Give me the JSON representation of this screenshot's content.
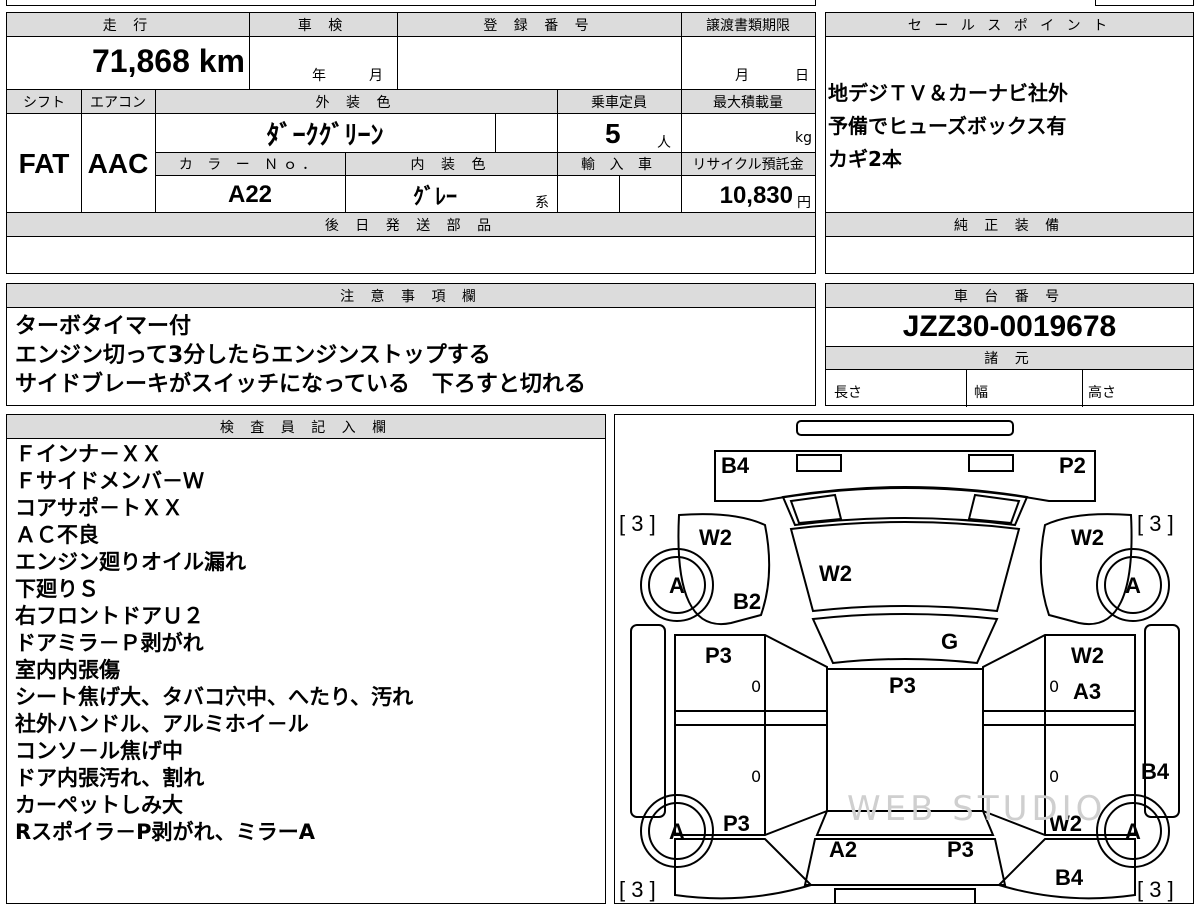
{
  "top_info": {
    "mileage_label": "走 行",
    "mileage_value": "71,868",
    "mileage_unit": "km",
    "inspection_label": "車 検",
    "inspection_year": "年",
    "inspection_month": "月",
    "registration_label": "登 録 番 号",
    "transfer_label": "譲渡書類期限",
    "transfer_month": "月",
    "transfer_day": "日"
  },
  "sales_points": {
    "label": "セ ー ル ス ポ イ ン ト",
    "lines": [
      "地デジＴＶ＆カーナビ社外",
      "予備でヒューズボックス有",
      "カギ2本"
    ]
  },
  "spec": {
    "shift_label": "シフト",
    "shift_value": "FAT",
    "aircon_label": "エアコン",
    "aircon_value": "AAC",
    "exterior_color_label": "外 装 色",
    "exterior_color_value": "ﾀﾞｰｸｸﾞﾘｰﾝ",
    "capacity_label": "乗車定員",
    "capacity_value": "5",
    "capacity_unit": "人",
    "max_load_label": "最大積載量",
    "max_load_unit": "kg",
    "color_no_label": "カ ラ ー Ｎｏ．",
    "color_no_value": "A22",
    "interior_color_label": "内 装 色",
    "interior_color_value": "ｸﾞﾚｰ",
    "interior_color_suffix": "系",
    "import_label": "輸 入 車",
    "recycle_label": "リサイクル預託金",
    "recycle_value": "10,830",
    "recycle_unit": "円"
  },
  "later_parts": {
    "label": "後 日 発 送 部 品"
  },
  "genuine_equipment": {
    "label": "純 正 装 備"
  },
  "notes": {
    "label": "注 意 事 項 欄",
    "lines": [
      "ターボタイマー付",
      "エンジン切って3分したらエンジンストップする",
      "サイドブレーキがスイッチになっている　下ろすと切れる"
    ]
  },
  "chassis": {
    "label": "車 台 番 号",
    "value": "JZZ30-0019678",
    "specs_label": "諸 元",
    "length_label": "長さ",
    "width_label": "幅",
    "height_label": "高さ"
  },
  "inspector": {
    "label": "検 査 員 記 入 欄",
    "lines": [
      "Ｆインナ－ＸＸ",
      "Ｆサイドメンバ－Ｗ",
      "コアサポ－トＸＸ",
      "ＡＣ不良",
      "エンジン廻りオイル漏れ",
      "下廻りＳ",
      "右フロントドアＵ２",
      "ドアミラ－Ｐ剥がれ",
      "室内内張傷",
      "シート焦げ大、タバコ穴中、へたり、汚れ",
      "社外ハンドル、アルミホイ－ル",
      "コンソ－ル焦げ中",
      "ドア内張汚れ、割れ",
      "カーペットしみ大",
      "Rスポイラ－P剥がれ、ミラーA"
    ]
  },
  "diagram": {
    "front_left_corner": "B4",
    "front_right_corner": "P2",
    "bracket_top_left": "[ 3 ]",
    "bracket_top_right": "[ 3 ]",
    "bracket_bottom_left": "[ 3 ]",
    "bracket_bottom_right": "[ 3 ]",
    "fender_left": "W2",
    "fender_right": "W2",
    "hood": "W2",
    "wheel_fl": "A",
    "wheel_fr": "A",
    "wheel_rl": "A",
    "wheel_rr": "A",
    "pillar_left": "B2",
    "windshield": "G",
    "door_front_left": "P3",
    "roof": "P3",
    "door_front_right": "W2",
    "door_front_right_2": "A3",
    "rocker_right": "B4",
    "qtr_left": "P3",
    "qtr_right": "W2",
    "trunk_left": "A2",
    "trunk_right": "P3",
    "rear_right_corner": "B4",
    "zero_1": "0",
    "zero_2": "0",
    "zero_3": "0",
    "zero_4": "0",
    "watermark": "WEB STUDIO"
  }
}
